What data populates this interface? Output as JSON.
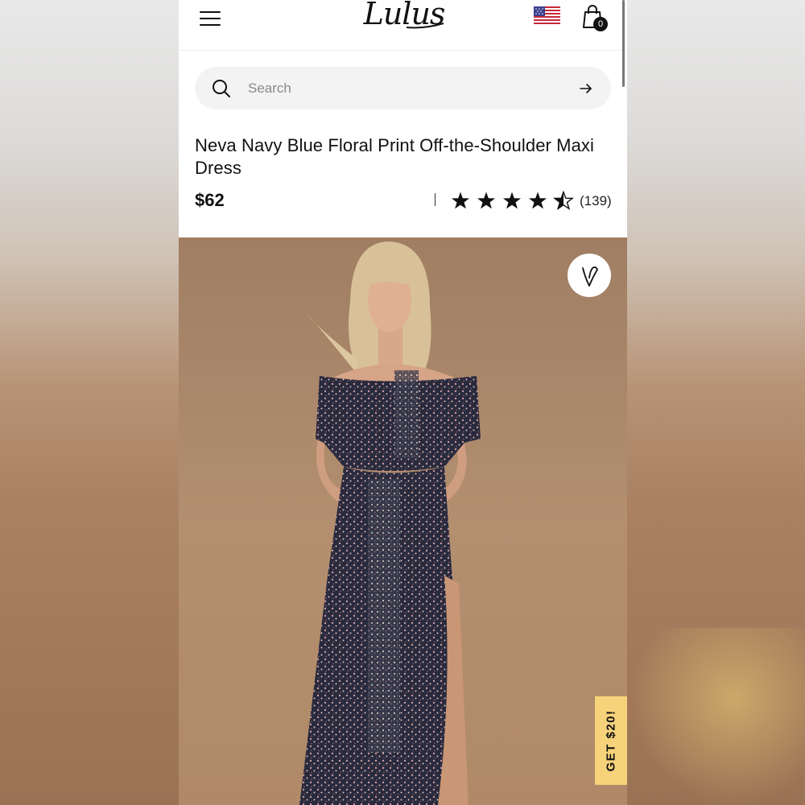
{
  "header": {
    "logo_text": "Lulus",
    "cart_count": "0",
    "icons": [
      "hamburger-menu-icon",
      "us-flag-icon",
      "shopping-bag-icon"
    ]
  },
  "search": {
    "placeholder": "Search",
    "value": ""
  },
  "product": {
    "title": "Neva Navy Blue Floral Print Off-the-Shoulder Maxi Dress",
    "price": "$62",
    "rating": 4.5,
    "rating_max": 5,
    "review_count": "(139)"
  },
  "promo": {
    "label": "GET $20!"
  },
  "colors": {
    "promo_bg": "#f6d27a",
    "search_bg": "#f3f3f3",
    "text": "#111111"
  }
}
